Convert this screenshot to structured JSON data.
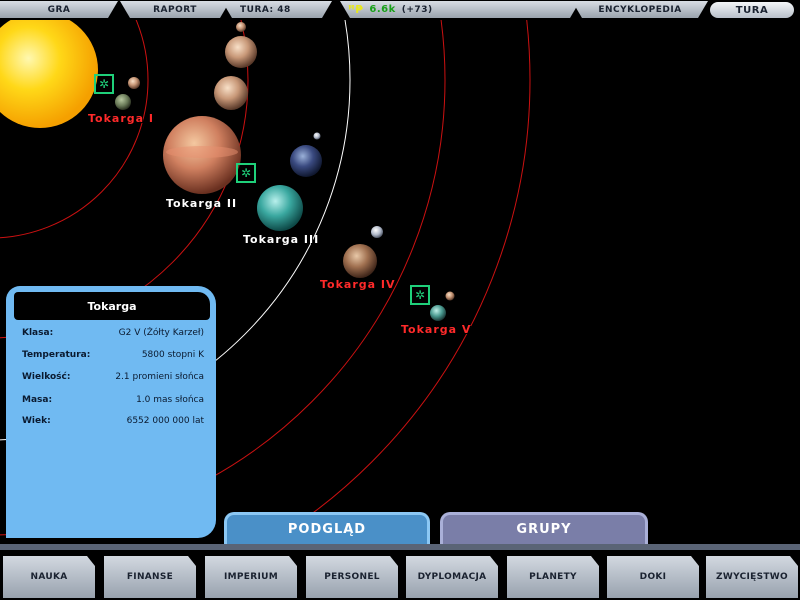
{
  "topbar": {
    "menu_gra": "GRA",
    "menu_raport": "RAPORT",
    "turn_label": "TURA:",
    "turn_number": "48",
    "money_icon": "AP",
    "credits": "6.6k",
    "credits_delta": "(+73)",
    "encyclopedia": "ENCYKLOPEDIA",
    "end_turn": "TURA"
  },
  "starmap": {
    "planets": [
      {
        "name": "Tokarga I",
        "color": "#ff2a2a"
      },
      {
        "name": "Tokarga II",
        "color": "#ffffff"
      },
      {
        "name": "Tokarga III",
        "color": "#ffffff"
      },
      {
        "name": "Tokarga IV",
        "color": "#ff2a2a"
      },
      {
        "name": "Tokarga V",
        "color": "#ff2a2a"
      }
    ],
    "colony_icon": "gear-icon"
  },
  "info_panel": {
    "title": "Tokarga",
    "rows": [
      {
        "label": "Klasa:",
        "value": "G2 V (Żółty Karzeł)"
      },
      {
        "label": "Temperatura:",
        "value": "5800 stopni K"
      },
      {
        "label": "Wielkość:",
        "value": "2.1 promieni słońca"
      },
      {
        "label": "Masa:",
        "value": "1.0 mas słońca"
      },
      {
        "label": "Wiek:",
        "value": "6552 000 000 lat"
      }
    ]
  },
  "view_tabs": {
    "podglad": "PODGLĄD",
    "grupy": "GRUPY"
  },
  "bottom_nav": [
    "NAUKA",
    "FINANSE",
    "IMPERIUM",
    "PERSONEL",
    "DYPLOMACJA",
    "PLANETY",
    "DOKI",
    "ZWYCIĘSTWO"
  ],
  "colors": {
    "panel_blue": "#70baf2",
    "orbit_red": "#cc1111",
    "orbit_white": "#ffffff",
    "colony_green": "#1fd07a",
    "credits_green": "#18a018"
  }
}
